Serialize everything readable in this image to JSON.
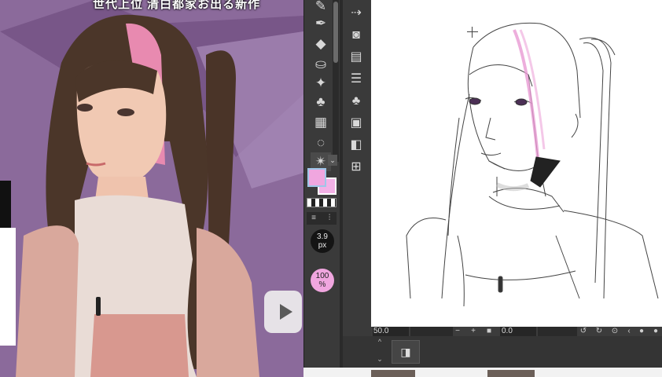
{
  "reference_photo": {
    "caption_text": "世代上位 清白都家お出る新作"
  },
  "tools": {
    "icons": [
      "pen-icon",
      "marker-icon",
      "eraser-icon",
      "fill-icon",
      "sparkle-icon",
      "blend-icon",
      "grid-icon",
      "lasso-icon",
      "star-burst-icon"
    ],
    "expand_glyph": "⌄",
    "main_color": "#f0a6df",
    "sub_color": "#f3b1e6"
  },
  "brush": {
    "size_value": "3.9",
    "size_unit": "px",
    "opacity_value": "100",
    "opacity_unit": "%"
  },
  "panel2": {
    "icons": [
      "navigator-icon",
      "layer-mask-icon",
      "layer-property-icon",
      "layer-list-icon",
      "subtool-icon",
      "animation-icon",
      "gradient-icon",
      "component-icon"
    ]
  },
  "status_bar": {
    "zoom": "50.0",
    "angle": "0.0",
    "minus": "−",
    "plus": "+",
    "stop": "■"
  },
  "dock": {
    "up": "^",
    "down": "⌄"
  }
}
